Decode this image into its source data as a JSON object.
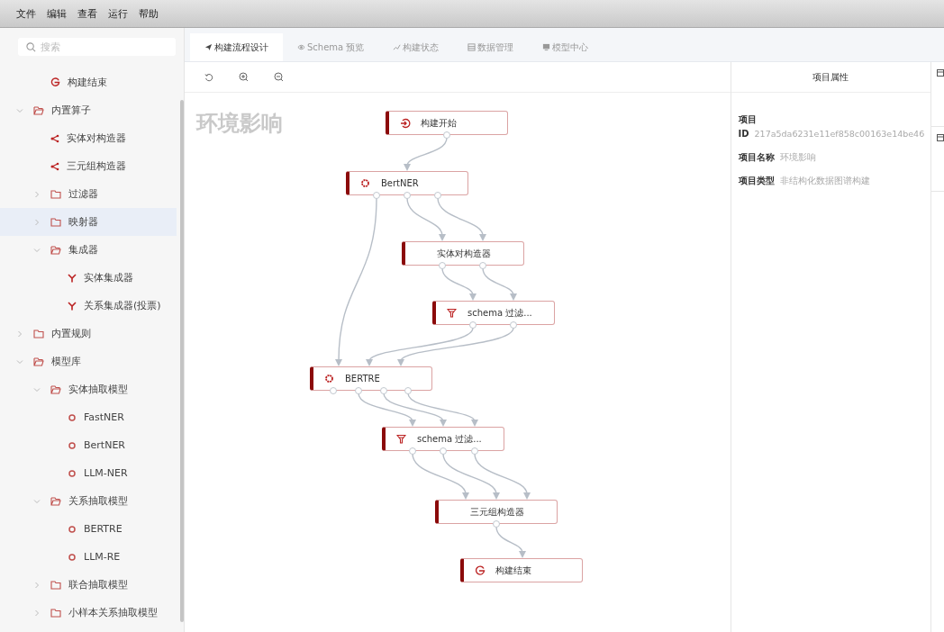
{
  "menu": [
    "文件",
    "编辑",
    "查看",
    "运行",
    "帮助"
  ],
  "search": {
    "placeholder": "搜索"
  },
  "tree": [
    {
      "label": "构建结束",
      "kind": "end",
      "selected": false
    },
    {
      "label": "内置算子",
      "kind": "folder",
      "expanded": true,
      "selected": false,
      "children": [
        {
          "label": "实体对构造器",
          "kind": "share",
          "selected": false
        },
        {
          "label": "三元组构造器",
          "kind": "share",
          "selected": false
        },
        {
          "label": "过滤器",
          "kind": "folder",
          "expanded": false,
          "selected": false
        },
        {
          "label": "映射器",
          "kind": "folder",
          "expanded": false,
          "selected": true
        },
        {
          "label": "集成器",
          "kind": "folder",
          "expanded": true,
          "selected": false,
          "children": [
            {
              "label": "实体集成器",
              "kind": "merge",
              "selected": false
            },
            {
              "label": "关系集成器(投票)",
              "kind": "merge",
              "selected": false
            }
          ]
        }
      ]
    },
    {
      "label": "内置规则",
      "kind": "folder",
      "expanded": false,
      "selected": false
    },
    {
      "label": "模型库",
      "kind": "folder",
      "expanded": true,
      "selected": false,
      "children": [
        {
          "label": "实体抽取模型",
          "kind": "folder",
          "expanded": true,
          "selected": false,
          "children": [
            {
              "label": "FastNER",
              "kind": "model",
              "selected": false
            },
            {
              "label": "BertNER",
              "kind": "model",
              "selected": false
            },
            {
              "label": "LLM-NER",
              "kind": "model",
              "selected": false
            }
          ]
        },
        {
          "label": "关系抽取模型",
          "kind": "folder",
          "expanded": true,
          "selected": false,
          "children": [
            {
              "label": "BERTRE",
              "kind": "model",
              "selected": false
            },
            {
              "label": "LLM-RE",
              "kind": "model",
              "selected": false
            }
          ]
        },
        {
          "label": "联合抽取模型",
          "kind": "folder",
          "expanded": false,
          "selected": false
        },
        {
          "label": "小样本关系抽取模型",
          "kind": "folder",
          "expanded": false,
          "selected": false
        }
      ]
    }
  ],
  "tabs": [
    {
      "label": "构建流程设计",
      "selected": true
    },
    {
      "label": "Schema 预览",
      "selected": false
    },
    {
      "label": "构建状态",
      "selected": false
    },
    {
      "label": "数据管理",
      "selected": false
    },
    {
      "label": "模型中心",
      "selected": false
    }
  ],
  "canvas": {
    "title": "环境影响",
    "nodes": [
      {
        "label": "构建开始",
        "kind": "start"
      },
      {
        "label": "BertNER",
        "kind": "model"
      },
      {
        "label": "实体对构造器",
        "kind": "plain"
      },
      {
        "label": "schema 过滤...",
        "kind": "filter"
      },
      {
        "label": "BERTRE",
        "kind": "model"
      },
      {
        "label": "schema 过滤...",
        "kind": "filter"
      },
      {
        "label": "三元组构造器",
        "kind": "plain"
      },
      {
        "label": "构建结束",
        "kind": "end"
      }
    ]
  },
  "properties": {
    "title": "项目属性",
    "rows": [
      {
        "label": "项目ID",
        "value": "217a5da6231e11ef858c00163e14be46"
      },
      {
        "label": "项目名称",
        "value": "环境影响"
      },
      {
        "label": "项目类型",
        "value": "非结构化数据图谱构建"
      }
    ]
  }
}
